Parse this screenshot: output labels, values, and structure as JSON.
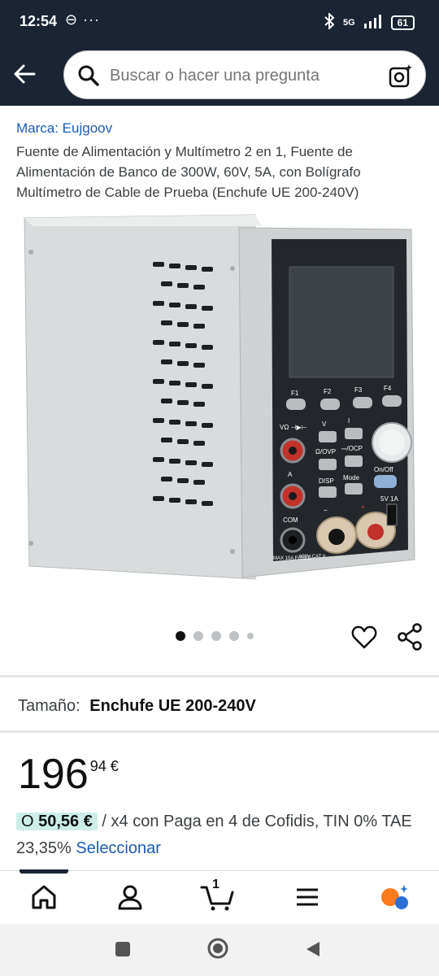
{
  "status_bar": {
    "time": "12:54",
    "extra": "⊖ ···",
    "network": "5G",
    "battery": "61"
  },
  "search": {
    "placeholder": "Buscar o hacer una pregunta"
  },
  "product": {
    "brand": "Marca: Eujgoov",
    "title": "Fuente de Alimentación y Multímetro 2 en 1, Fuente de Alimentación de Banco de 300W, 60V, 5A, con Bolígrafo Multímetro de Cable de Prueba (Enchufe UE 200-240V)",
    "image_labels": {
      "f1": "F1",
      "f2": "F2",
      "f3": "F3",
      "f4": "F4",
      "v_ohm": "VΩ ⊣▶⊢",
      "v": "V",
      "i": "I",
      "ovp": "Ω/OVP",
      "ocp": "⎓/OCP",
      "a": "A",
      "disp": "DISP",
      "mode": "Mode",
      "onoff": "On/Off",
      "usb": "5V 1A",
      "com": "COM",
      "minus": "−",
      "plus": "+",
      "max_fused": "MAX 10A FUSED",
      "cat": "600V CAT II"
    },
    "image_dots": {
      "count": 5,
      "active_index": 0
    }
  },
  "size": {
    "label": "Tamaño:",
    "value": "Enchufe UE 200-240V"
  },
  "price": {
    "whole": "196",
    "fraction": "94 €"
  },
  "installment": {
    "prefix": "O",
    "amount": "50,56 €",
    "text": "/ x4 con Paga en 4 de Cofidis, TIN 0% TAE 23,35%",
    "link": "Seleccionar"
  },
  "bottom_nav": {
    "items": [
      "home",
      "account",
      "cart",
      "menu",
      "rufus"
    ],
    "cart_count": "1",
    "active": "home"
  },
  "colors": {
    "header_bg": "#1a2433",
    "link": "#1e5bb0",
    "pill_bg": "#cdeee8",
    "accent_orange": "#ff9900"
  }
}
